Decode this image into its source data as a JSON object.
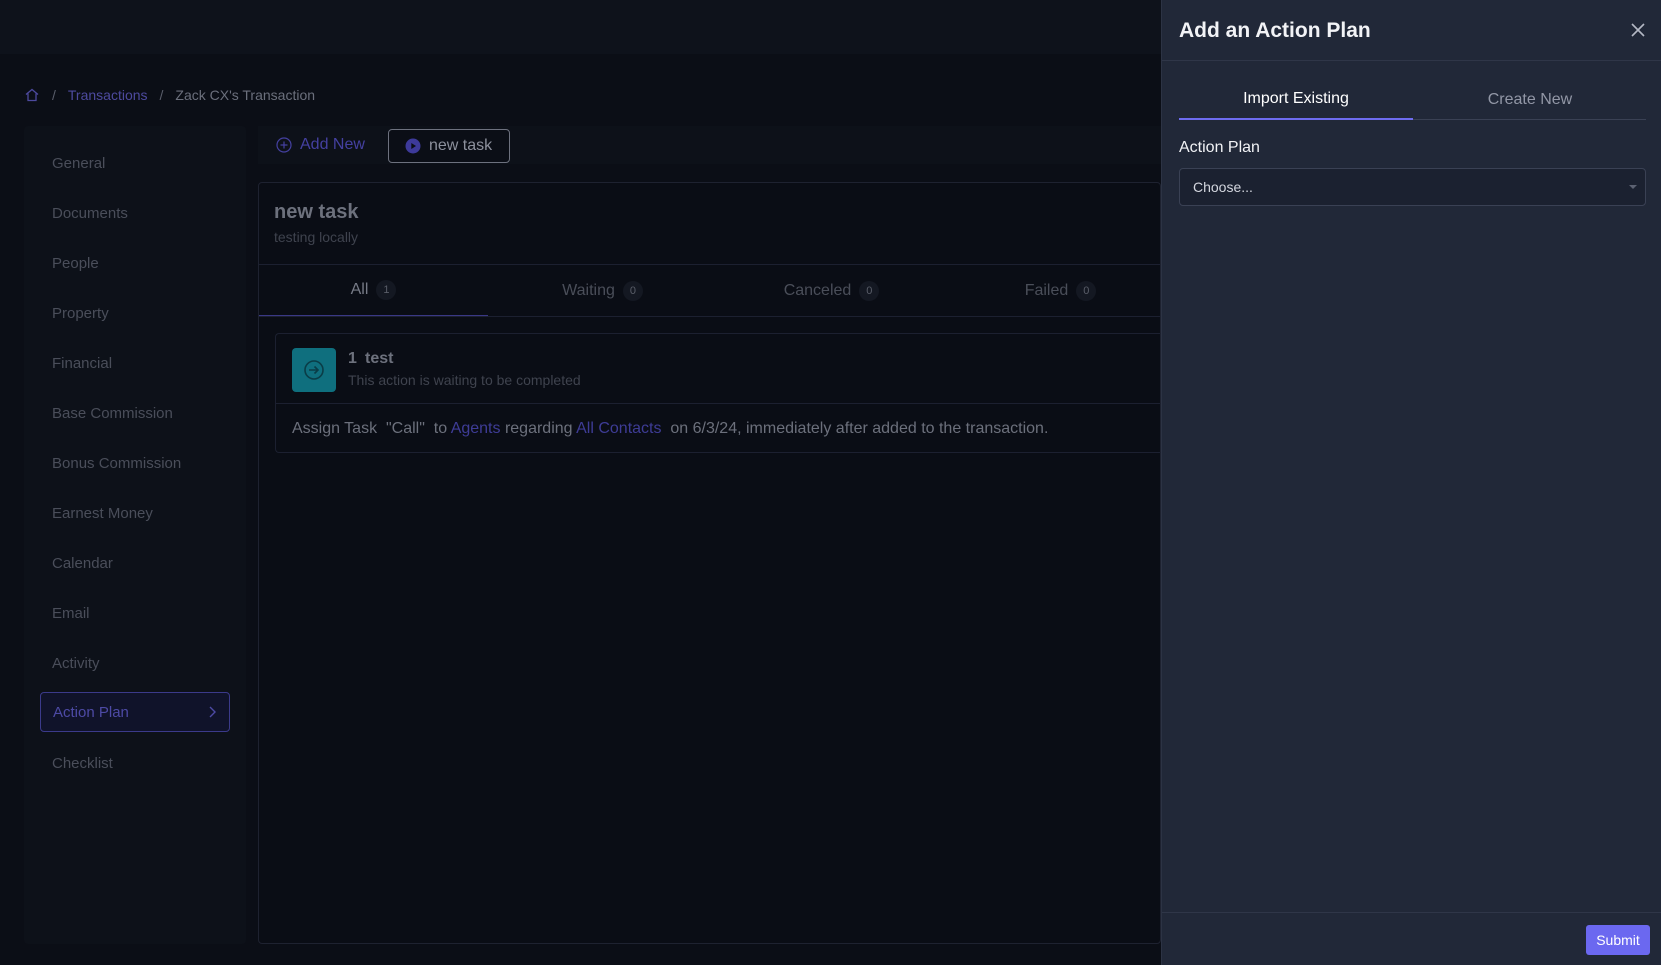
{
  "breadcrumb": {
    "home_icon": "home-icon",
    "separator": "/",
    "transactions": "Transactions",
    "current": "Zack CX's Transaction"
  },
  "sidebar": {
    "items": [
      {
        "label": "General"
      },
      {
        "label": "Documents"
      },
      {
        "label": "People"
      },
      {
        "label": "Property"
      },
      {
        "label": "Financial"
      },
      {
        "label": "Base Commission"
      },
      {
        "label": "Bonus Commission"
      },
      {
        "label": "Earnest Money"
      },
      {
        "label": "Calendar"
      },
      {
        "label": "Email"
      },
      {
        "label": "Activity"
      },
      {
        "label": "Action Plan",
        "active": true
      },
      {
        "label": "Checklist"
      }
    ]
  },
  "toolbar": {
    "add_new_label": "Add New",
    "new_task_label": "new task"
  },
  "task": {
    "title": "new task",
    "subtitle": "testing locally"
  },
  "tabs": [
    {
      "label": "All",
      "count": "1"
    },
    {
      "label": "Waiting",
      "count": "0"
    },
    {
      "label": "Canceled",
      "count": "0"
    },
    {
      "label": "Failed",
      "count": "0"
    }
  ],
  "action": {
    "number": "1",
    "name": "test",
    "status": "This action is waiting to be completed",
    "desc_prefix": "Assign Task  \"Call\"  to ",
    "desc_agents": "Agents",
    "desc_regarding": " regarding ",
    "desc_contacts": "All Contacts",
    "desc_suffix": "  on 6/3/24, immediately after added to the transaction."
  },
  "drawer": {
    "title": "Add an Action Plan",
    "tabs": [
      {
        "label": "Import Existing",
        "active": true
      },
      {
        "label": "Create New",
        "active": false
      }
    ],
    "field_label": "Action Plan",
    "select_placeholder": "Choose...",
    "submit_label": "Submit"
  },
  "colors": {
    "accent": "#6b68f0",
    "action_icon_bg": "#0f6f7e"
  }
}
